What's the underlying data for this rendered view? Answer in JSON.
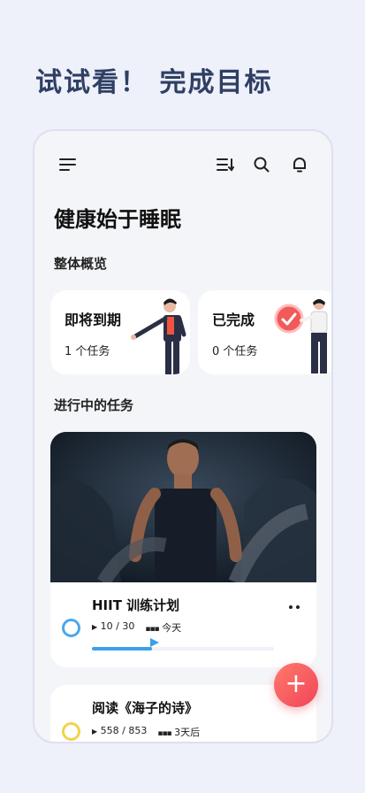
{
  "promo": {
    "title": "试试看！ 完成目标"
  },
  "app": {
    "title": "健康始于睡眠"
  },
  "overview": {
    "section_title": "整体概览",
    "cards": [
      {
        "title": "即将到期",
        "count": "1 个任务"
      },
      {
        "title": "已完成",
        "count": "0 个任务"
      }
    ]
  },
  "in_progress": {
    "section_title": "进行中的任务",
    "tasks": [
      {
        "title": "HIIT 训练计划",
        "progress": "10 / 30",
        "due": "今天",
        "progress_fraction": 0.33,
        "ring_color": "#4aa8ee"
      },
      {
        "title": "阅读《海子的诗》",
        "progress": "558 / 853",
        "due": "3天后",
        "ring_color": "#f2d24a"
      }
    ]
  },
  "icons": {
    "menu": "menu-icon",
    "sort": "sort-icon",
    "search": "search-icon",
    "notification": "bell-icon",
    "add": "plus-icon",
    "more": "more-icon",
    "play": "play-icon",
    "calendar": "calendar-icon"
  },
  "fab_label": "+",
  "colors": {
    "accent": "#3aa0ea",
    "fab": "#f0455a",
    "title": "#2f3f63"
  }
}
